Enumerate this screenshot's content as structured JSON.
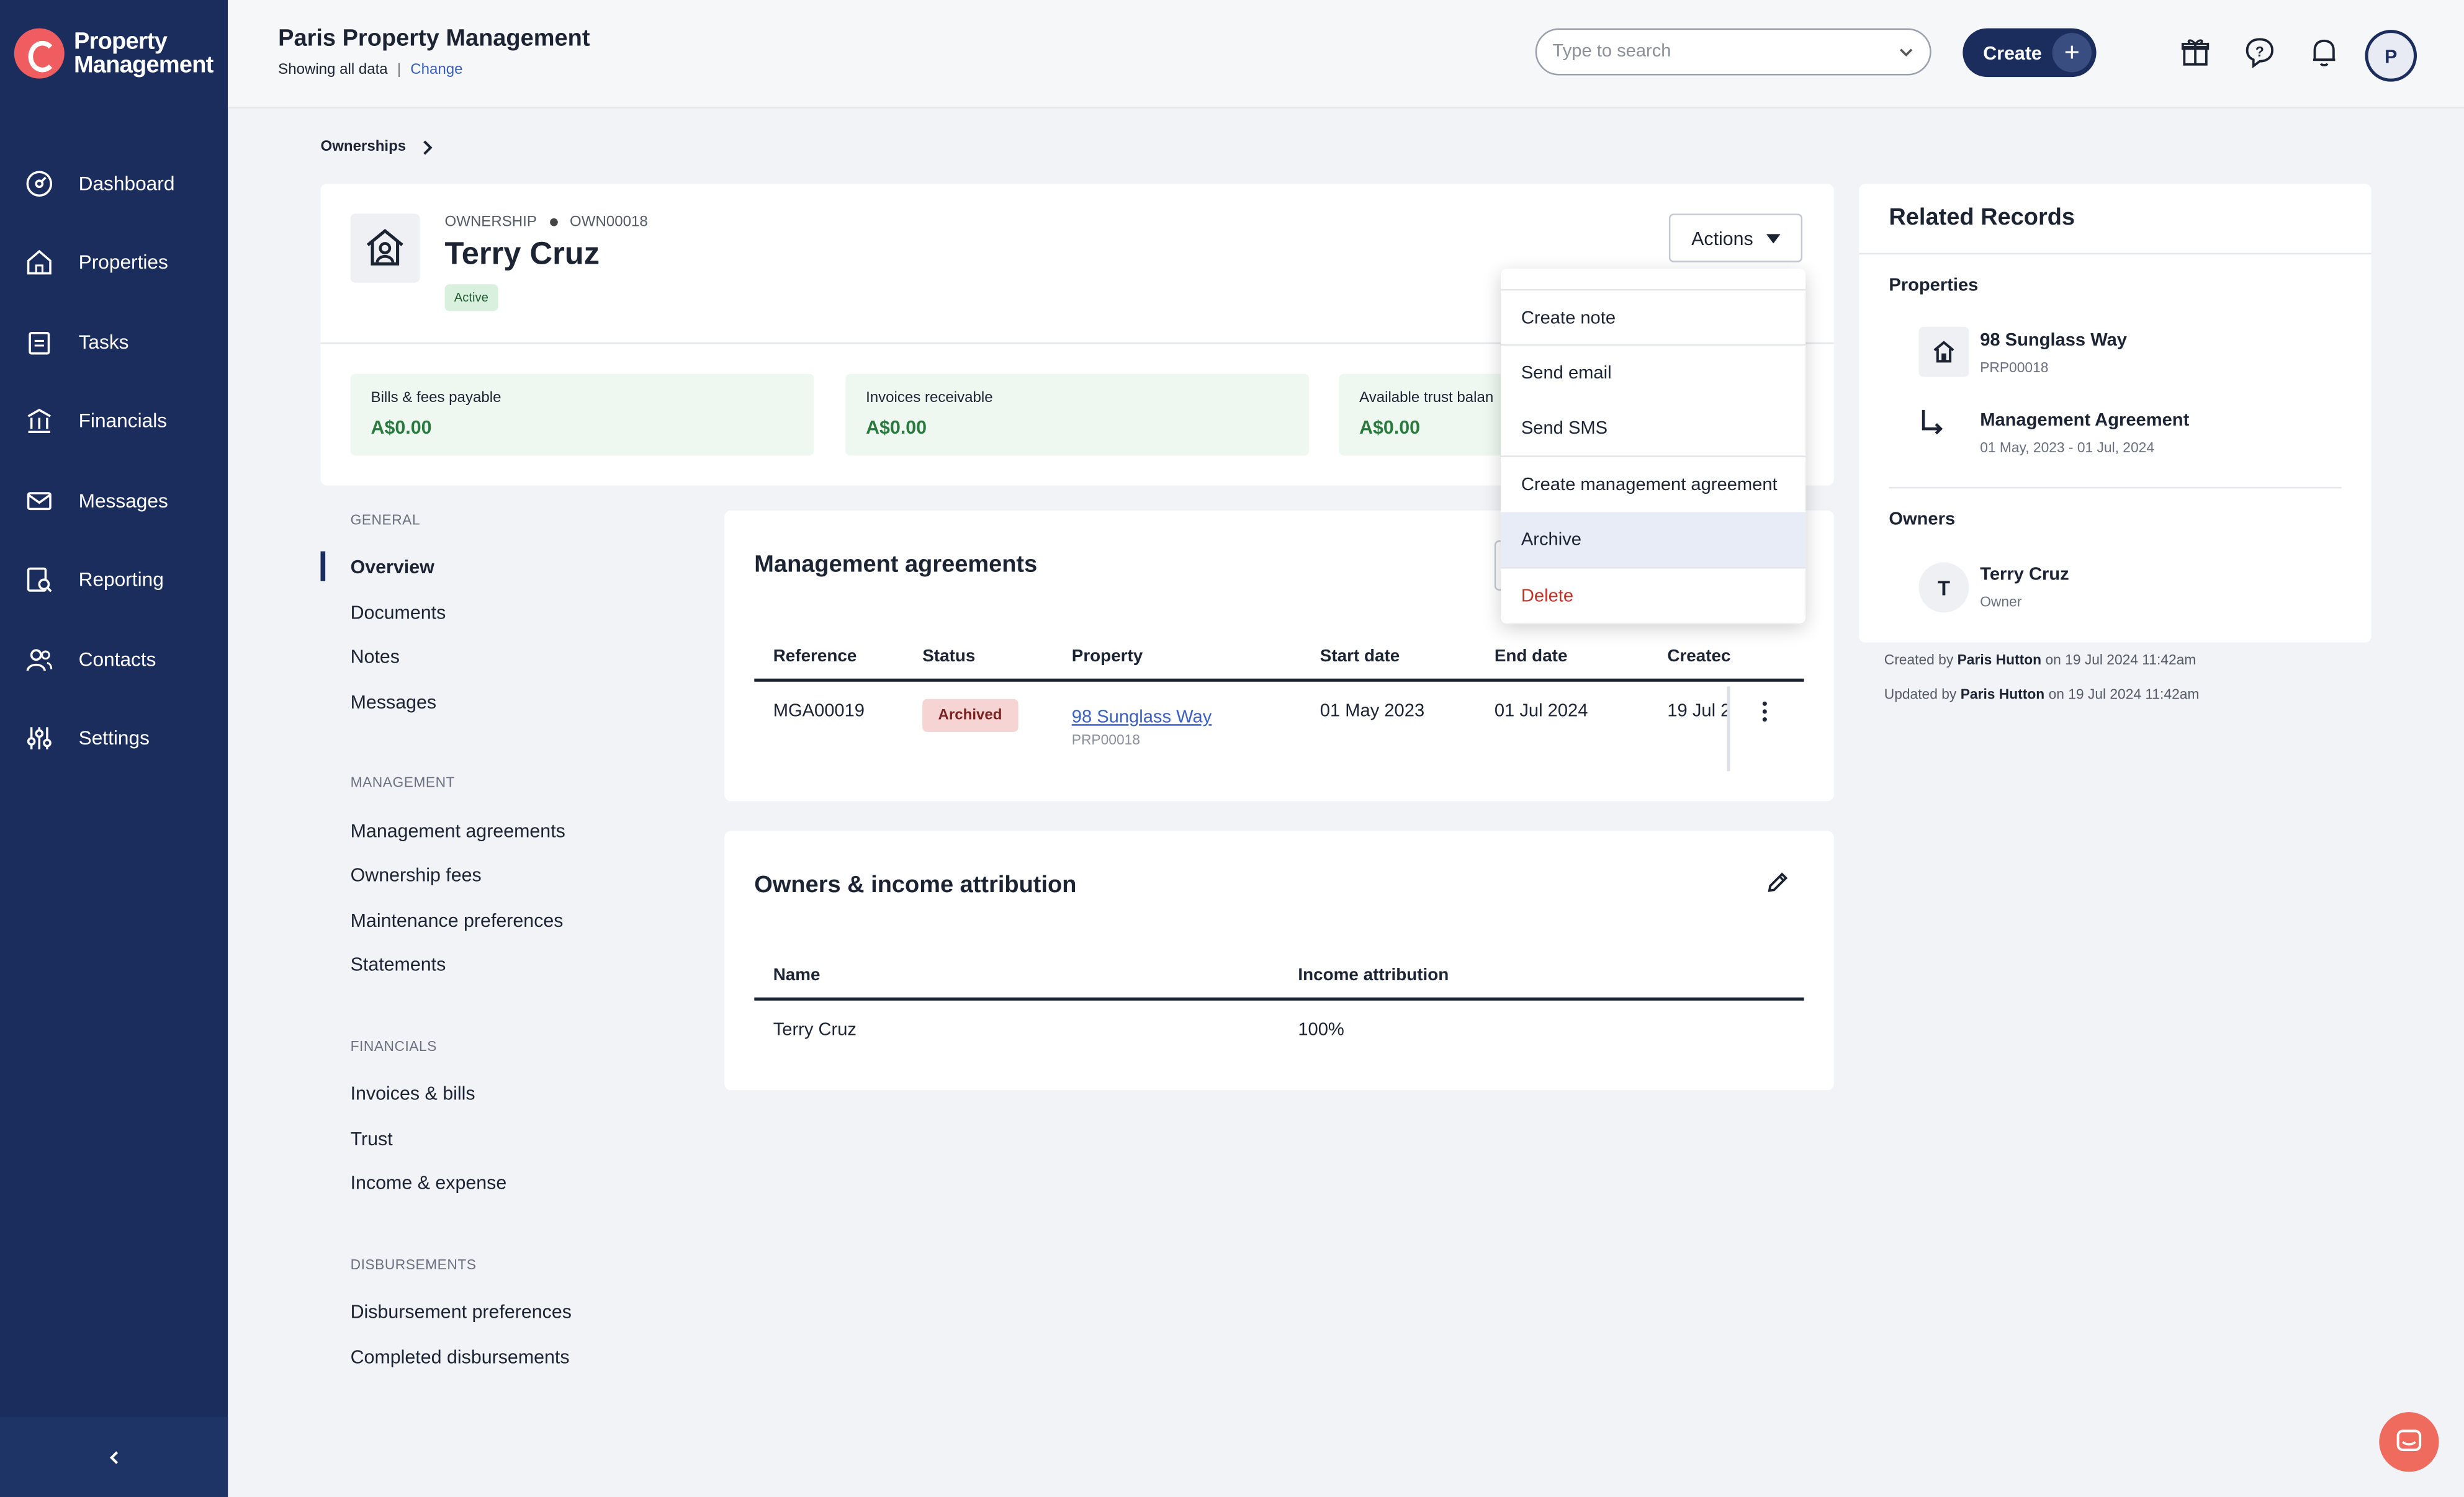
{
  "app": {
    "logo_line1": "Property",
    "logo_line2": "Management",
    "org_title": "Paris Property Management",
    "showing": "Showing all data",
    "change": "Change"
  },
  "sidebar": {
    "items": [
      {
        "label": "Dashboard",
        "icon": "dashboard-icon"
      },
      {
        "label": "Properties",
        "icon": "house-icon"
      },
      {
        "label": "Tasks",
        "icon": "clipboard-icon"
      },
      {
        "label": "Financials",
        "icon": "bank-icon"
      },
      {
        "label": "Messages",
        "icon": "envelope-icon"
      },
      {
        "label": "Reporting",
        "icon": "report-icon"
      },
      {
        "label": "Contacts",
        "icon": "people-icon"
      },
      {
        "label": "Settings",
        "icon": "sliders-icon"
      }
    ]
  },
  "topbar": {
    "search_placeholder": "Type to search",
    "create_label": "Create",
    "avatar_initial": "P"
  },
  "breadcrumb": {
    "label": "Ownerships"
  },
  "ownership": {
    "type_label": "OWNERSHIP",
    "code": "OWN00018",
    "name": "Terry Cruz",
    "status": "Active",
    "actions_label": "Actions",
    "bills_label": "Bills & fees payable",
    "bills_value": "A$0.00",
    "invoices_label": "Invoices receivable",
    "invoices_value": "A$0.00",
    "trust_label": "Available trust balan",
    "trust_value": "A$0.00"
  },
  "section_nav": {
    "general_head": "GENERAL",
    "general": [
      "Overview",
      "Documents",
      "Notes",
      "Messages"
    ],
    "management_head": "MANAGEMENT",
    "management": [
      "Management agreements",
      "Ownership fees",
      "Maintenance preferences",
      "Statements"
    ],
    "financials_head": "FINANCIALS",
    "financials": [
      "Invoices & bills",
      "Trust",
      "Income & expense"
    ],
    "disbursements_head": "DISBURSEMENTS",
    "disbursements": [
      "Disbursement preferences",
      "Completed disbursements"
    ]
  },
  "management_agreements": {
    "title": "Management agreements",
    "columns": [
      "Reference",
      "Status",
      "Property",
      "Start date",
      "End date",
      "Createc"
    ],
    "rows": [
      {
        "reference": "MGA00019",
        "status": "Archived",
        "property": "98 Sunglass Way",
        "property_code": "PRP00018",
        "start": "01 May 2023",
        "end": "01 Jul 2024",
        "created": "19 Jul 2"
      }
    ]
  },
  "owners_income": {
    "title": "Owners & income attribution",
    "columns": [
      "Name",
      "Income attribution"
    ],
    "rows": [
      {
        "name": "Terry Cruz",
        "attribution": "100%"
      }
    ]
  },
  "related": {
    "title": "Related Records",
    "properties_head": "Properties",
    "property_name": "98 Sunglass Way",
    "property_code": "PRP00018",
    "agreement_name": "Management Agreement",
    "agreement_dates": "01 May, 2023 - 01 Jul, 2024",
    "owners_head": "Owners",
    "owner_initial": "T",
    "owner_name": "Terry Cruz",
    "owner_role": "Owner"
  },
  "audit": {
    "created_prefix": "Created by",
    "created_by": "Paris Hutton",
    "created_on": "on 19 Jul 2024 11:42am",
    "updated_prefix": "Updated by",
    "updated_by": "Paris Hutton",
    "updated_on": "on 19 Jul 2024 11:42am"
  },
  "actions_menu": {
    "items": [
      "Create note",
      "Send email",
      "Send SMS",
      "Create management agreement",
      "Archive",
      "Delete"
    ],
    "highlight": "Archive",
    "danger": "Delete"
  },
  "colors": {
    "sidebar": "#1b2d5c",
    "accent": "#3b5fc0",
    "danger": "#c0332b",
    "success_bg": "#eef8f0",
    "brand": "#ef5d60"
  }
}
